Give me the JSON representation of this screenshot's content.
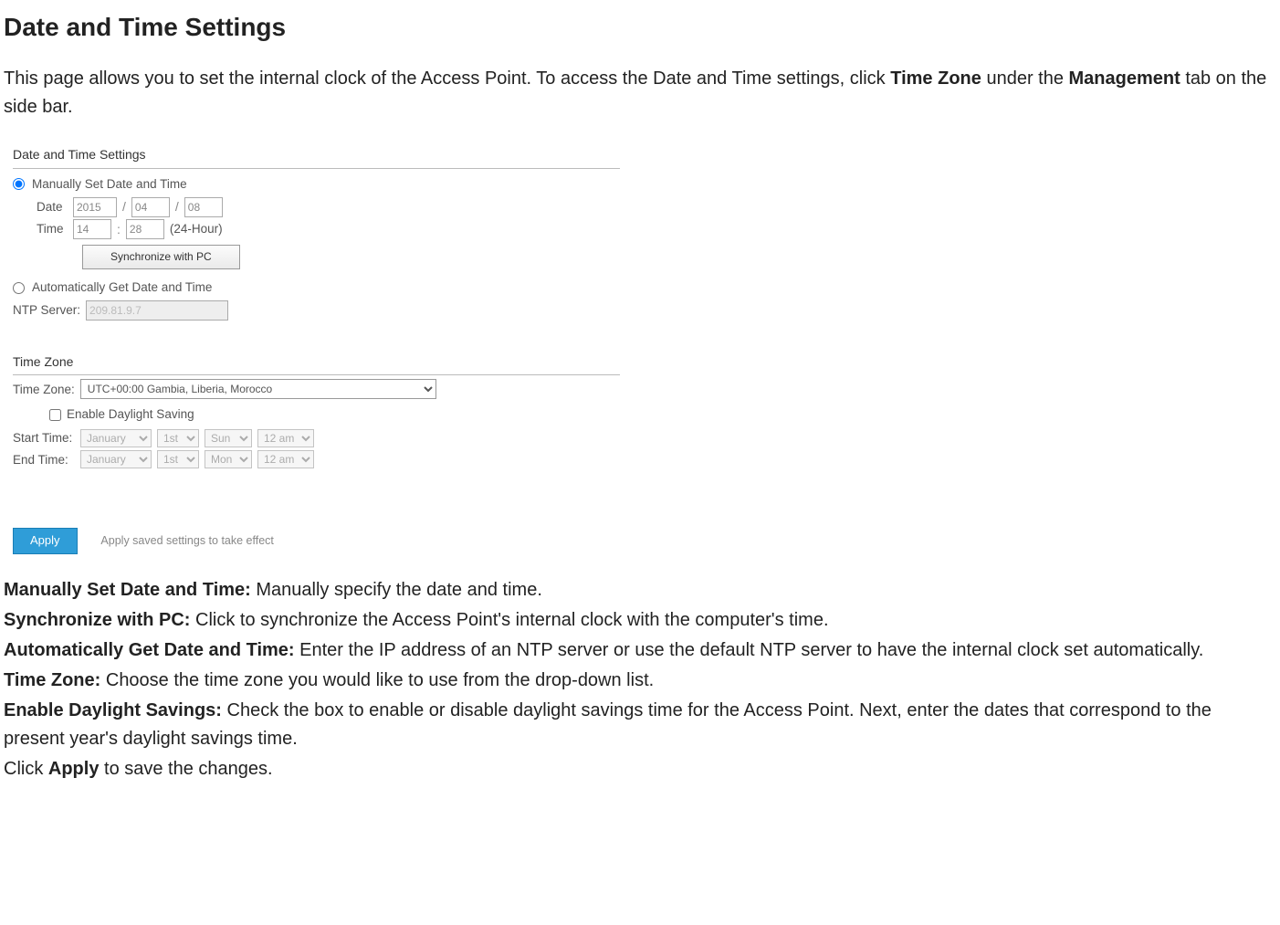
{
  "page_title": "Date and Time Settings",
  "intro_pre": "This page allows you to set the internal clock of the Access Point. To access the Date and Time settings, click ",
  "intro_bold1": "Time Zone",
  "intro_mid": " under the ",
  "intro_bold2": "Management",
  "intro_post": " tab on the side bar.",
  "panel": {
    "heading": "Date and Time Settings",
    "manual_label": "Manually Set Date and Time",
    "date_label": "Date",
    "date_year": "2015",
    "date_month": "04",
    "date_day": "08",
    "time_label": "Time",
    "time_hour": "14",
    "time_min": "28",
    "time_suffix": "(24-Hour)",
    "sync_btn": "Synchronize with PC",
    "auto_label": "Automatically Get Date and Time",
    "ntp_label": "NTP Server:",
    "ntp_value": "209.81.9.7",
    "tz_heading": "Time Zone",
    "tz_label": "Time Zone:",
    "tz_value": "UTC+00:00 Gambia, Liberia, Morocco",
    "dst_label": "Enable Daylight Saving",
    "start_label": "Start Time:",
    "end_label": "End Time:",
    "sel_month": "January",
    "sel_week": "1st",
    "sel_day_sun": "Sun",
    "sel_day_mon": "Mon",
    "sel_hour": "12 am",
    "apply_btn": "Apply",
    "apply_caption": "Apply saved settings to take effect"
  },
  "defs": {
    "manual_t": "Manually Set Date and Time:",
    "manual_d": " Manually specify the date and time.",
    "sync_t": "Synchronize with PC:",
    "sync_d": " Click to synchronize the Access Point's internal clock with the computer's time.",
    "auto_t": "Automatically Get Date and Time:",
    "auto_d": " Enter the IP address of an NTP server or use the default NTP server to have the internal clock set automatically.",
    "tz_t": "Time Zone:",
    "tz_d": " Choose the time zone you would like to use from the drop-down list.",
    "dst_t": "Enable Daylight Savings:",
    "dst_d": " Check the box to enable or disable daylight savings time for the Access Point. Next, enter the dates that correspond to the present year's daylight savings time.",
    "apply_pre": "Click ",
    "apply_t": "Apply",
    "apply_post": " to save the changes."
  }
}
